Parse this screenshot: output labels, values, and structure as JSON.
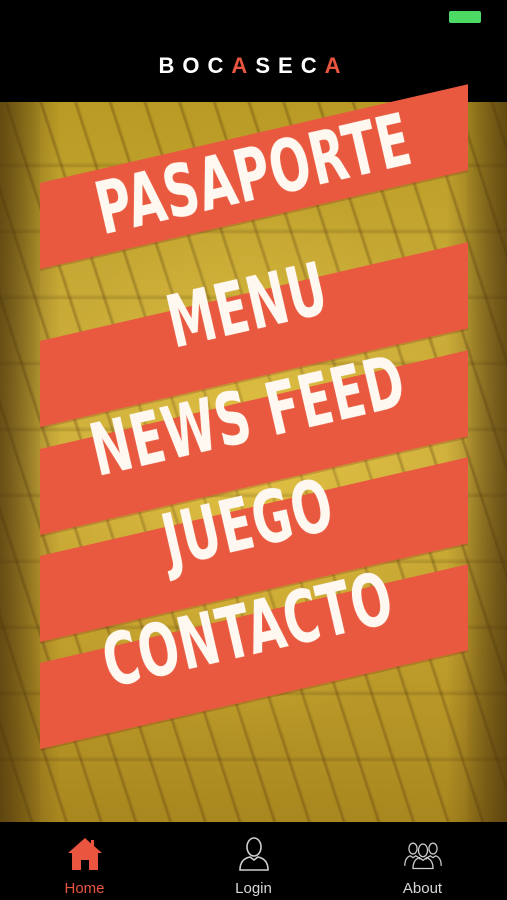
{
  "status_bar": {
    "battery_color": "#4cd964"
  },
  "header": {
    "logo_letters": [
      {
        "char": "B",
        "accent": false
      },
      {
        "char": "O",
        "accent": false
      },
      {
        "char": "C",
        "accent": false
      },
      {
        "char": "A",
        "accent": true
      },
      {
        "char": "S",
        "accent": false
      },
      {
        "char": "E",
        "accent": false
      },
      {
        "char": "C",
        "accent": false
      },
      {
        "char": "A",
        "accent": true
      }
    ],
    "accent_color": "#e9553f"
  },
  "menu": {
    "items": [
      {
        "label": "PASAPORTE"
      },
      {
        "label": "MENU"
      },
      {
        "label": "NEWS FEED"
      },
      {
        "label": "JUEGO"
      },
      {
        "label": "CONTACTO"
      }
    ],
    "banner_color": "#e9593f"
  },
  "tabs": {
    "items": [
      {
        "label": "Home",
        "icon": "home-icon",
        "active": true
      },
      {
        "label": "Login",
        "icon": "user-icon",
        "active": false
      },
      {
        "label": "About",
        "icon": "group-icon",
        "active": false
      }
    ],
    "active_color": "#e9553f",
    "inactive_color": "#d8d8d8"
  }
}
